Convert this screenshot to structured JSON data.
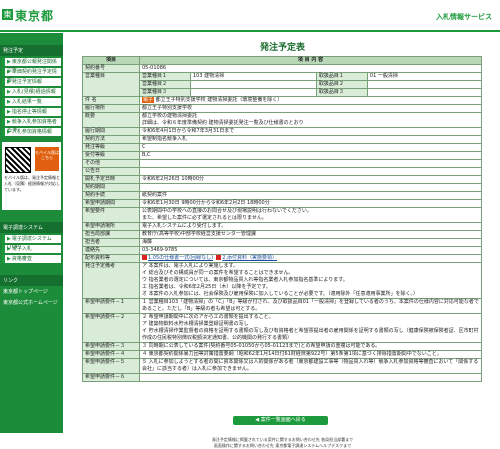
{
  "header": {
    "logo_mark": "東",
    "logo": "東京都",
    "site_title": "入札情報サービス"
  },
  "sidebar": {
    "section1": "発注予定",
    "items": [
      {
        "label": "東京都公報発注関係公告"
      },
      {
        "label": "単価契約発注予定情報"
      },
      {
        "label": "発注予定情報"
      },
      {
        "label": "入札(見積)経過情報"
      },
      {
        "label": "入札結果一覧"
      },
      {
        "label": "指名停止等情報"
      },
      {
        "label": "競争入札参加資格者名簿"
      },
      {
        "label": "入札参加資格情報"
      }
    ],
    "mobile_btn": "モバイル版はこちら",
    "qr_text": "モバイル版は、発注予定情報と入札（見積）経過情報が対応しています。",
    "section2": "電子調達システム",
    "items2": [
      {
        "label": "電子調達システム(TOP)"
      },
      {
        "label": "電子入札"
      },
      {
        "label": "資格審査"
      }
    ],
    "section3": "リンク",
    "links": [
      {
        "label": "東京都トップページ"
      },
      {
        "label": "東京都公式ホームページ"
      }
    ]
  },
  "main": {
    "title": "発注予定表",
    "col_item": "項目",
    "col_content": "項 目 内 容",
    "rows": {
      "contract_no": {
        "label": "契約番号",
        "value": "05-01086"
      },
      "business_type": {
        "label": "営業種目",
        "rows": [
          {
            "sub": "営業種目１",
            "value": "103 建物清掃",
            "sub2": "取扱品目１",
            "value2": "01 一般清掃"
          },
          {
            "sub": "営業種目２",
            "value": "",
            "sub2": "取扱品目２",
            "value2": ""
          },
          {
            "sub": "営業種目３",
            "value": "",
            "sub2": "取扱品目３",
            "value2": ""
          }
        ]
      },
      "name": {
        "label": "件 名",
        "mark": "電子",
        "value": "都立王子特別支援学校 建物清掃委託（環境整備を除く）"
      },
      "place": {
        "label": "履行場所",
        "value": "都立王子特別支援学校"
      },
      "overview": {
        "label": "概要",
        "value1": "都立学校の建物清掃委託",
        "value2": "詳細は、令和６年度準備契約 建物清掃委託発注一覧及び仕様書のとおり"
      },
      "period": {
        "label": "履行期間",
        "value": "令和6年4月1日から令和7年3月31日まで"
      },
      "method": {
        "label": "契約方法",
        "value": "希望制指名競争入札"
      },
      "rank": {
        "label": "発注等級",
        "value": "C"
      },
      "rank_range": {
        "label": "受付等級",
        "value": "B,C"
      },
      "other": {
        "label": "その他",
        "value": ""
      },
      "announce_date": {
        "label": "公告日",
        "value": ""
      },
      "bid_date": {
        "label": "開札予定日時",
        "value": "令和6年2月26日 10時00分"
      },
      "contract_period": {
        "label": "契約期間",
        "value": ""
      },
      "procedure": {
        "label": "契約手続",
        "value": "紙契約案件"
      },
      "period2": {
        "label": "希望申請期間",
        "value": "令和6年1月30日 9時00分から令和6年2月2日 18時00分"
      },
      "hope": {
        "label": "希望要件",
        "value1": "公表期間中の学校への直接のお問合せ及び現場説明は行わないでください。",
        "value2": "また、希望した案件に必ず選定されるとは限りません。"
      },
      "apply": {
        "label": "希望申請場所",
        "value": "電子入札システムにより受付します。"
      },
      "dept": {
        "label": "担当局部課",
        "value": "教育庁(高等学校)中部学校経営支援センター管理課"
      },
      "contact": {
        "label": "担当者",
        "value": "海藤"
      },
      "tel": {
        "label": "連絡先",
        "value": "03-3469-9785"
      },
      "file": {
        "label": "配布資料等",
        "value1": "1.05の仕様書一式(回線なし)",
        "value2": "2.添付資料（実施要領）"
      },
      "cond": {
        "label": "発注予定備考",
        "lines": [
          "ア 本案件は、電子入札により実施します。",
          "イ 総合及びその構成員が同一の案件を希望することはできません。",
          "ウ 指名業者の選定については、東京都物品買入れ等指名業者入札参加指名基準によります。",
          "エ 指名業者は、令和6年2月25日（木）以降を予定です。",
          "オ 本案件の入札参加には、社会保険及び雇用保険に加入していることが必要です。（適用除外「任意適用事業所」を除く。）"
        ]
      },
      "req1": {
        "label": "希望申請要件－１",
        "lines": [
          "１ 営業種目103「建物清掃」の「C」「B」等級が付され、及び取扱品目01「一般清掃」を登録している者のうち、本案件の仕様内容に対応可能な者であること。ただし「B」等級の者も希望は可とする。"
        ]
      },
      "req2": {
        "label": "希望申請要件－２",
        "lines": [
          "２ 希望申請期間中に次のアからエの書類を提出すること。",
          "ア 建築物飲料水貯水槽清掃業登録証明書の写し",
          "イ 貯水槽清掃作業監督者の資格を証明する書類の写し及び有資格者と希望票提出者の雇用関係を証明する書類の写し（健康保険被保険者証、区市町村作成の住民税特別徴収税額決定通知書、公的機関の発行する書類）"
        ]
      },
      "req3": {
        "label": "希望申請要件－３",
        "lines": [
          "３ 同時期に公表している案件(契約番号05-01050から05-01123まで)との希望申請の重複は可能である。"
        ]
      },
      "req4": {
        "label": "希望申請要件－４",
        "lines": [
          "４ 東京都契約関係暴力団等対策措置要綱（昭和62年1月14日付61財経庶第922号）第5条第1項に基づく排除措置期間中でないこと。"
        ]
      },
      "req5": {
        "label": "希望申請要件－５",
        "lines": [
          "５ 入札に参加しようとする者の間に資本関係又は人的関係がある者（東京都建設工事等（物品買入れ等）競争入札参加資格等審査において「関係する会社」に該当する者）は入札に参加できません。"
        ]
      },
      "req6": {
        "label": "希望申請要件－６",
        "value": ""
      }
    },
    "back_btn": "◀ 案件一覧画面へ戻る"
  },
  "footer": {
    "line1": "発注予定情報に掲載されている案件に関するお問い合わせ先 各局担当部署まで",
    "line2": "画面操作に関するお問い合わせ先 東京都電子調達システムヘルプデスクまで"
  }
}
